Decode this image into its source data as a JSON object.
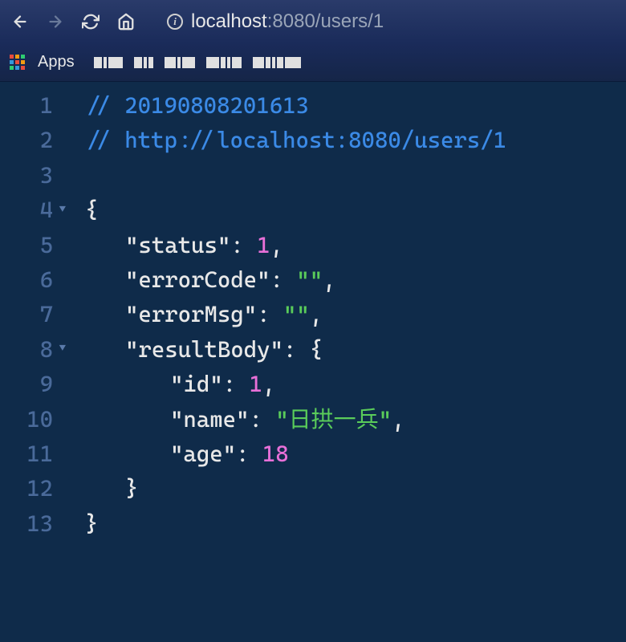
{
  "browser": {
    "url_host": "localhost",
    "url_port_path": ":8080/users/1",
    "apps_label": "Apps"
  },
  "code": {
    "lines": [
      {
        "n": "1",
        "fold": "",
        "content": [
          {
            "t": "comment",
            "v": "// 20190808201613"
          }
        ]
      },
      {
        "n": "2",
        "fold": "",
        "content": [
          {
            "t": "comment",
            "v": "// http://localhost:8080/users/1"
          }
        ]
      },
      {
        "n": "3",
        "fold": "",
        "content": []
      },
      {
        "n": "4",
        "fold": "▼",
        "content": [
          {
            "t": "brace",
            "v": "{"
          }
        ]
      },
      {
        "n": "5",
        "fold": "",
        "indent": 1,
        "content": [
          {
            "t": "key",
            "v": "status"
          },
          {
            "t": "colon",
            "v": ": "
          },
          {
            "t": "num",
            "v": "1"
          },
          {
            "t": "punct",
            "v": ","
          }
        ]
      },
      {
        "n": "6",
        "fold": "",
        "indent": 1,
        "content": [
          {
            "t": "key",
            "v": "errorCode"
          },
          {
            "t": "colon",
            "v": ": "
          },
          {
            "t": "str",
            "v": "\"\""
          },
          {
            "t": "punct",
            "v": ","
          }
        ]
      },
      {
        "n": "7",
        "fold": "",
        "indent": 1,
        "content": [
          {
            "t": "key",
            "v": "errorMsg"
          },
          {
            "t": "colon",
            "v": ": "
          },
          {
            "t": "str",
            "v": "\"\""
          },
          {
            "t": "punct",
            "v": ","
          }
        ]
      },
      {
        "n": "8",
        "fold": "▼",
        "indent": 1,
        "content": [
          {
            "t": "key",
            "v": "resultBody"
          },
          {
            "t": "colon",
            "v": ": "
          },
          {
            "t": "brace",
            "v": "{"
          }
        ]
      },
      {
        "n": "9",
        "fold": "",
        "indent": 2,
        "content": [
          {
            "t": "key",
            "v": "id"
          },
          {
            "t": "colon",
            "v": ": "
          },
          {
            "t": "num",
            "v": "1"
          },
          {
            "t": "punct",
            "v": ","
          }
        ]
      },
      {
        "n": "10",
        "fold": "",
        "indent": 2,
        "content": [
          {
            "t": "key",
            "v": "name"
          },
          {
            "t": "colon",
            "v": ": "
          },
          {
            "t": "str",
            "v": "\"日拱一兵\""
          },
          {
            "t": "punct",
            "v": ","
          }
        ]
      },
      {
        "n": "11",
        "fold": "",
        "indent": 2,
        "content": [
          {
            "t": "key",
            "v": "age"
          },
          {
            "t": "colon",
            "v": ": "
          },
          {
            "t": "num",
            "v": "18"
          }
        ]
      },
      {
        "n": "12",
        "fold": "",
        "indent": 1,
        "content": [
          {
            "t": "brace",
            "v": "}"
          }
        ]
      },
      {
        "n": "13",
        "fold": "",
        "content": [
          {
            "t": "brace",
            "v": "}"
          }
        ]
      }
    ]
  }
}
